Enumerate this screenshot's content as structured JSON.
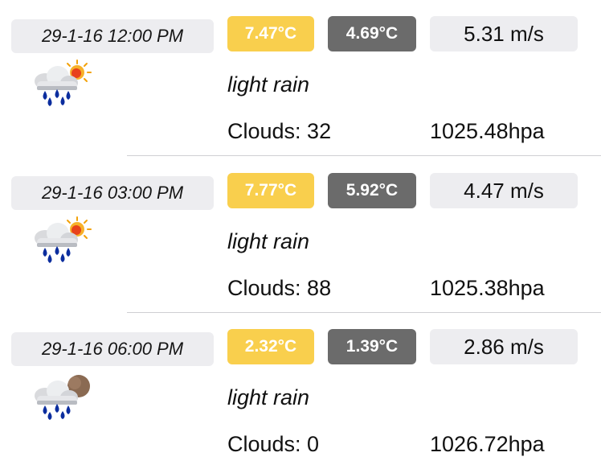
{
  "forecasts": [
    {
      "datetime": "29-1-16 12:00 PM",
      "temp_max": "7.47°C",
      "temp_min": "4.69°C",
      "wind": "5.31 m/s",
      "description": "light rain",
      "clouds": "Clouds: 32",
      "pressure": "1025.48hpa",
      "icon": "rain-cloud-sun-icon"
    },
    {
      "datetime": "29-1-16 03:00 PM",
      "temp_max": "7.77°C",
      "temp_min": "5.92°C",
      "wind": "4.47 m/s",
      "description": "light rain",
      "clouds": "Clouds: 88",
      "pressure": "1025.38hpa",
      "icon": "rain-cloud-sun-icon"
    },
    {
      "datetime": "29-1-16 06:00 PM",
      "temp_max": "2.32°C",
      "temp_min": "1.39°C",
      "wind": "2.86 m/s",
      "description": "light rain",
      "clouds": "Clouds: 0",
      "pressure": "1026.72hpa",
      "icon": "rain-cloud-moon-icon"
    }
  ],
  "colors": {
    "temp_max_bg": "#f9cf4d",
    "temp_min_bg": "#6b6b6b",
    "chip_bg": "#ededf0",
    "rain_drop": "#0b2d9e",
    "sun": "#f2a20a",
    "moon": "#8a6a52"
  }
}
